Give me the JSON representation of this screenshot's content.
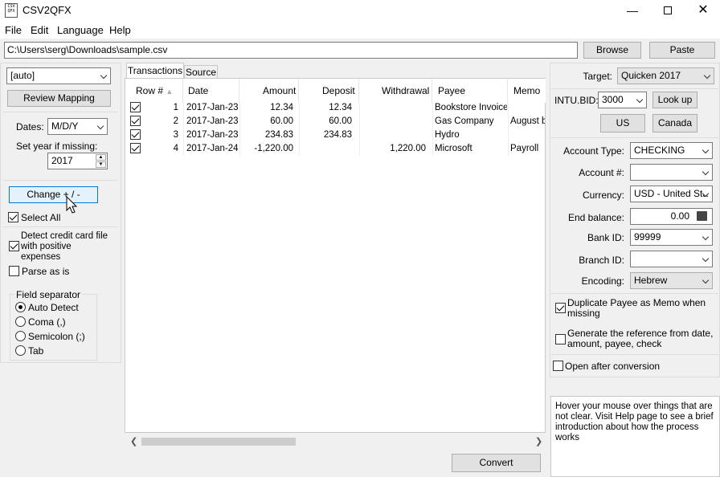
{
  "window": {
    "title": "CSV2QFX",
    "icon_text": "CSV QFX"
  },
  "menu": [
    "File",
    "Edit",
    "Language",
    "Help"
  ],
  "path": {
    "value": "C:\\Users\\serg\\Downloads\\sample.csv",
    "browse": "Browse",
    "paste": "Paste"
  },
  "left": {
    "mapping_select": "[auto]",
    "review_mapping": "Review Mapping",
    "dates_label": "Dates:",
    "dates_value": "M/D/Y",
    "year_label": "Set year if missing:",
    "year_value": "2017",
    "change_sign": "Change + / -",
    "select_all": "Select All",
    "detect_cc": "Detect credit card file with positive expenses",
    "parse_as_is": "Parse as is",
    "field_sep_title": "Field separator",
    "separators": [
      "Auto Detect",
      "Coma (,)",
      "Semicolon (;)",
      "Tab"
    ]
  },
  "tabs": [
    "Transactions",
    "Source"
  ],
  "table": {
    "columns": [
      "Row #",
      "Date",
      "Amount",
      "Deposit",
      "Withdrawal",
      "Payee",
      "Memo"
    ],
    "rows": [
      {
        "n": "1",
        "date": "2017-Jan-23",
        "amount": "12.34",
        "deposit": "12.34",
        "withdrawal": "",
        "payee": "Bookstore Invoice",
        "memo": ""
      },
      {
        "n": "2",
        "date": "2017-Jan-23",
        "amount": "60.00",
        "deposit": "60.00",
        "withdrawal": "",
        "payee": "Gas Company",
        "memo": "August b"
      },
      {
        "n": "3",
        "date": "2017-Jan-23",
        "amount": "234.83",
        "deposit": "234.83",
        "withdrawal": "",
        "payee": "Hydro",
        "memo": ""
      },
      {
        "n": "4",
        "date": "2017-Jan-24",
        "amount": "-1,220.00",
        "deposit": "",
        "withdrawal": "1,220.00",
        "payee": "Microsoft",
        "memo": "Payroll"
      }
    ]
  },
  "convert": "Convert",
  "right": {
    "target_label": "Target:",
    "target_value": "Quicken 2017",
    "intu_label": "INTU.BID:",
    "intu_value": "3000",
    "lookup": "Look up",
    "us": "US",
    "canada": "Canada",
    "account_type_label": "Account Type:",
    "account_type_value": "CHECKING",
    "account_num_label": "Account #:",
    "account_num_value": "",
    "currency_label": "Currency:",
    "currency_value": "USD - United Sta",
    "end_balance_label": "End balance:",
    "end_balance_value": "0.00",
    "bank_id_label": "Bank ID:",
    "bank_id_value": "99999",
    "branch_id_label": "Branch ID:",
    "branch_id_value": "",
    "encoding_label": "Encoding:",
    "encoding_value": "Hebrew",
    "dup_payee": "Duplicate Payee as Memo when missing",
    "gen_ref": "Generate the reference from date, amount, payee, check",
    "open_after": "Open after conversion",
    "hover_info": "Hover your mouse over things that are not clear. Visit Help page to see a brief introduction about how the process works"
  }
}
